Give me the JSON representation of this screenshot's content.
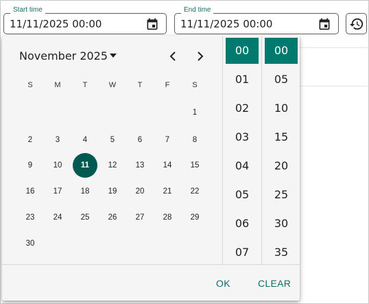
{
  "start_field": {
    "label": "Start time",
    "value": "11/11/2025 00:00"
  },
  "end_field": {
    "label": "End time",
    "value": "11/11/2025 00:00"
  },
  "calendar": {
    "month_label": "November 2025",
    "weekdays": [
      "S",
      "M",
      "T",
      "W",
      "T",
      "F",
      "S"
    ],
    "days": [
      "1",
      "2",
      "3",
      "4",
      "5",
      "6",
      "7",
      "8",
      "9",
      "10",
      "11",
      "12",
      "13",
      "14",
      "15",
      "16",
      "17",
      "18",
      "19",
      "20",
      "21",
      "22",
      "23",
      "24",
      "25",
      "26",
      "27",
      "28",
      "29",
      "30"
    ],
    "selected_day": "11"
  },
  "hours": [
    "00",
    "01",
    "02",
    "03",
    "04",
    "05",
    "06",
    "07"
  ],
  "minutes": [
    "00",
    "05",
    "10",
    "15",
    "20",
    "25",
    "30",
    "35"
  ],
  "selected_hour": "00",
  "selected_minute": "00",
  "actions": {
    "ok": "OK",
    "clear": "CLEAR"
  },
  "colors": {
    "accent": "#007a6e",
    "selected_day": "#005a52",
    "label": "#0f6e66"
  }
}
